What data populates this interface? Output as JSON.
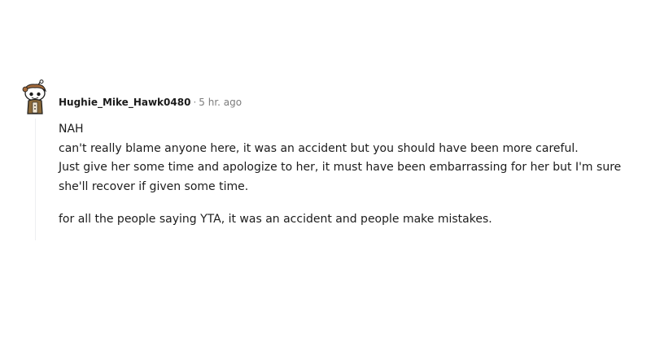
{
  "comment": {
    "username": "Hughie_Mike_Hawk0480",
    "separator": "·",
    "timestamp": "5 hr. ago",
    "avatar": {
      "icon": "snoo-avatar-icon",
      "colors": {
        "hat": "#a46b3c",
        "face": "#ffffff",
        "outline": "#1c1c1c",
        "shirt": "#8b6a3b"
      }
    },
    "body": [
      "NAH",
      "can't really blame anyone here, it was an accident but you should have been more careful.",
      "Just give her some time and apologize to her, it must have been embarrassing for her but I'm sure she'll recover if given some time.",
      "for all the people saying YTA, it was an accident and people make mistakes."
    ]
  }
}
